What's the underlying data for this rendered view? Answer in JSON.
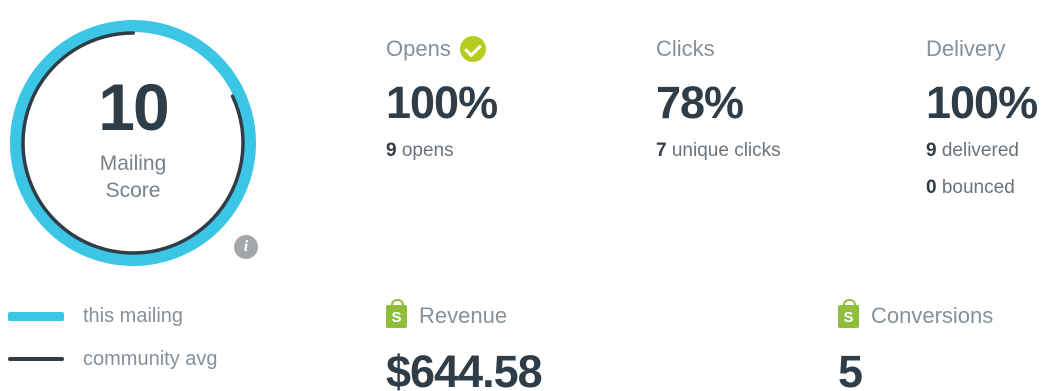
{
  "score": {
    "value": "10",
    "label_line1": "Mailing",
    "label_line2": "Score",
    "info_icon": "info-icon",
    "this_mailing_fraction": 1.0,
    "community_avg_fraction": 0.82,
    "this_mailing_color": "#3cc6e6",
    "community_color": "#2f3d48"
  },
  "stats": {
    "opens": {
      "label": "Opens",
      "value": "100%",
      "sub_count": "9",
      "sub_text": "opens",
      "badge_icon": "check-circle-icon",
      "badge_color": "#b6cc1e"
    },
    "clicks": {
      "label": "Clicks",
      "value": "78%",
      "sub_count": "7",
      "sub_text": "unique clicks"
    },
    "delivery": {
      "label": "Delivery",
      "value": "100%",
      "delivered_count": "9",
      "delivered_text": "delivered",
      "bounced_count": "0",
      "bounced_text": "bounced"
    }
  },
  "legend": {
    "this_mailing": "this mailing",
    "community_avg": "community avg"
  },
  "commerce": {
    "revenue": {
      "label": "Revenue",
      "value": "$644.58",
      "icon": "shopping-bag-icon"
    },
    "conversions": {
      "label": "Conversions",
      "value": "5",
      "icon": "shopping-bag-icon"
    },
    "icon_color": "#8fbf3a"
  }
}
